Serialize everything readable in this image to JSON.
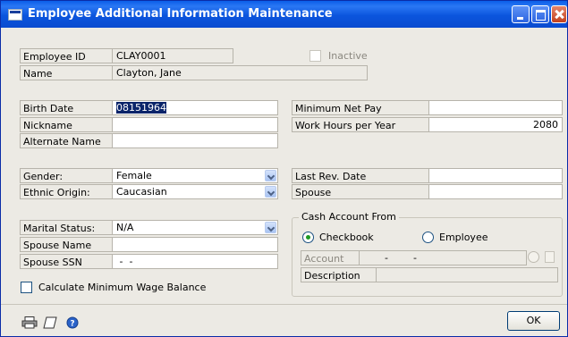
{
  "window": {
    "title": "Employee Additional Information Maintenance",
    "title_bar_color": "#0a5ee8"
  },
  "employee_id": {
    "label": "Employee ID",
    "value": "CLAY0001"
  },
  "inactive": {
    "label": "Inactive",
    "checked": false
  },
  "name": {
    "label": "Name",
    "value": "Clayton, Jane"
  },
  "birth_date": {
    "label": "Birth Date",
    "value": "08151964"
  },
  "nickname": {
    "label": "Nickname",
    "value": ""
  },
  "alternate_name": {
    "label": "Alternate Name",
    "value": ""
  },
  "minimum_net_pay": {
    "label": "Minimum Net Pay",
    "value": ""
  },
  "work_hours": {
    "label": "Work Hours per Year",
    "value": "2080"
  },
  "gender": {
    "label": "Gender:",
    "value": "Female"
  },
  "ethnic_origin": {
    "label": "Ethnic Origin:",
    "value": "Caucasian"
  },
  "last_rev_date": {
    "label": "Last Rev. Date",
    "value": ""
  },
  "spouse": {
    "label": "Spouse",
    "value": ""
  },
  "marital_status": {
    "label": "Marital Status:",
    "value": "N/A"
  },
  "spouse_name": {
    "label": "Spouse Name",
    "value": ""
  },
  "spouse_ssn": {
    "label": "Spouse SSN",
    "value": " -  -"
  },
  "calc_min_wage": {
    "label": "Calculate Minimum Wage Balance",
    "checked": false
  },
  "cash_account": {
    "legend": "Cash Account From",
    "options": [
      "Checkbook",
      "Employee"
    ],
    "selected": "Checkbook",
    "account_label": "Account",
    "account_value": "-        -",
    "description_label": "Description",
    "description_value": ""
  },
  "footer": {
    "icons": [
      "printer-icon",
      "note-icon",
      "help-icon"
    ],
    "ok_label": "OK"
  }
}
